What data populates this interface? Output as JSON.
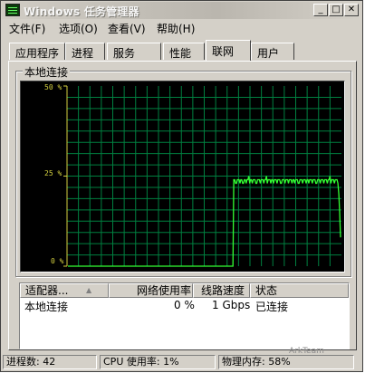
{
  "window": {
    "title": "Windows 任务管理器",
    "controls": {
      "minimize": "_",
      "maximize": "□",
      "close": "✕"
    }
  },
  "menu": [
    {
      "label": "文件(F)"
    },
    {
      "label": "选项(O)"
    },
    {
      "label": "查看(V)"
    },
    {
      "label": "帮助(H)"
    }
  ],
  "tabs": [
    {
      "label": "应用程序"
    },
    {
      "label": "进程"
    },
    {
      "label": "服务"
    },
    {
      "label": "性能"
    },
    {
      "label": "联网",
      "active": true
    },
    {
      "label": "用户"
    }
  ],
  "graph": {
    "group_label": "本地连接",
    "colors": {
      "background": "#000000",
      "grid": "#008040",
      "line": "#33ff33",
      "axis": "#d4d040"
    }
  },
  "chart_data": {
    "type": "line",
    "y_tick_labels": [
      "50 %",
      "25 %",
      "0 %"
    ],
    "ylim": [
      0,
      50
    ],
    "grid": true,
    "series": [
      {
        "values": [
          0,
          0,
          0,
          0,
          0,
          0,
          0,
          0,
          0,
          0,
          0,
          0,
          0,
          0,
          0,
          0,
          0,
          0,
          0,
          0,
          0,
          0,
          0,
          0,
          0,
          0,
          0,
          0,
          0,
          0,
          0,
          0,
          0,
          0,
          0,
          0,
          0,
          0,
          0,
          0,
          0,
          0,
          0,
          0,
          0,
          0,
          0,
          0,
          0,
          0,
          0,
          0,
          0,
          0,
          0,
          0,
          0,
          0,
          0,
          0,
          0,
          0,
          0,
          0,
          0,
          0,
          0,
          0,
          0,
          0,
          0,
          0,
          0,
          0,
          0,
          0,
          0,
          0,
          0,
          0,
          0,
          0,
          0,
          0,
          0,
          0,
          0,
          0,
          0,
          0,
          0,
          0,
          0,
          0,
          0,
          0,
          0,
          0,
          0,
          0,
          0,
          0,
          0,
          0,
          0,
          0,
          0,
          0,
          0,
          0,
          0,
          0,
          0,
          0,
          0,
          0,
          0,
          0,
          0,
          0,
          0,
          0,
          0,
          0,
          0,
          0,
          0,
          0,
          0,
          0,
          0,
          0,
          0,
          0,
          0,
          0,
          0,
          0,
          0,
          0,
          0,
          0,
          0,
          0,
          0,
          0,
          0,
          0,
          0,
          0,
          0,
          0,
          0,
          0,
          0,
          0,
          0,
          0,
          0,
          0,
          0,
          0,
          0,
          0,
          0,
          0,
          0,
          0,
          0,
          0,
          0,
          0,
          0,
          0,
          0,
          0,
          0,
          0,
          0,
          0,
          0,
          0,
          0,
          0,
          0,
          0,
          0,
          0,
          24,
          24,
          23,
          23,
          24,
          24,
          24,
          23,
          24,
          24,
          23,
          23,
          24,
          24,
          23,
          24,
          24,
          25,
          23,
          24,
          24,
          23,
          24,
          24,
          24,
          23,
          23,
          24,
          24,
          24,
          23,
          24,
          24,
          24,
          23,
          24,
          24,
          25,
          23,
          24,
          24,
          24,
          23,
          24,
          24,
          23,
          24,
          24,
          24,
          23,
          24,
          24,
          24,
          23,
          23,
          24,
          24,
          24,
          23,
          24,
          24,
          24,
          23,
          24,
          24,
          24,
          23,
          24,
          24,
          23,
          24,
          24,
          24,
          23,
          23,
          24,
          24,
          24,
          23,
          24,
          24,
          24,
          23,
          24,
          24,
          23,
          24,
          24,
          24,
          23,
          24,
          24,
          24,
          23,
          23,
          24,
          24,
          24,
          23,
          24,
          24,
          24,
          23,
          24,
          24,
          24,
          23,
          24,
          24,
          25,
          23,
          24,
          24,
          24,
          23,
          24,
          24,
          24,
          23,
          20,
          15,
          8
        ]
      }
    ]
  },
  "adapter_table": {
    "columns": [
      {
        "label": "适配器..."
      },
      {
        "label": "网络使用率"
      },
      {
        "label": "线路速度"
      },
      {
        "label": "状态"
      }
    ],
    "sort_indicator": "▲",
    "rows": [
      {
        "name": "本地连接",
        "usage": "0 %",
        "speed": "1 Gbps",
        "state": "已连接"
      }
    ]
  },
  "statusbar": {
    "processes": "进程数: 42",
    "cpu": "CPU 使用率: 1%",
    "memory": "物理内存: 58%"
  },
  "watermark": "ArkTeam"
}
